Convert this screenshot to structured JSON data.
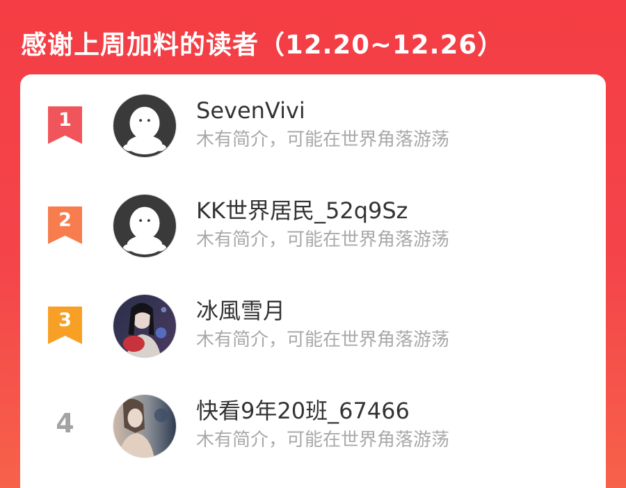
{
  "header": {
    "title": "感谢上周加料的读者（12.20~12.26）"
  },
  "colors": {
    "background_top": "#f43d44",
    "background_bottom": "#f7624a",
    "rank_1": "#f0555c",
    "rank_2": "#f77d4e",
    "rank_3": "#f8a025",
    "rank_plain": "#a3a3a3"
  },
  "readers": [
    {
      "rank": "1",
      "name": "SevenVivi",
      "bio": "木有简介，可能在世界角落游荡",
      "avatar": "default-avatar"
    },
    {
      "rank": "2",
      "name": "KK世界居民_52q9Sz",
      "bio": "木有简介，可能在世界角落游荡",
      "avatar": "default-avatar"
    },
    {
      "rank": "3",
      "name": "冰風雪月",
      "bio": "木有简介，可能在世界角落游荡",
      "avatar": "photo-avatar"
    },
    {
      "rank": "4",
      "name": "快看9年20班_67466",
      "bio": "木有简介，可能在世界角落游荡",
      "avatar": "photo-avatar"
    }
  ]
}
